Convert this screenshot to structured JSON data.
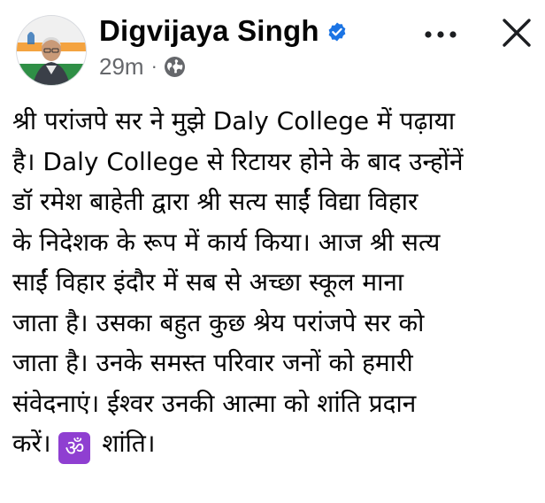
{
  "post": {
    "author": {
      "name": "Digvijaya Singh",
      "verified": true
    },
    "time": "29m",
    "separator": "·",
    "audience_icon": "globe-icon",
    "text_lines": [
      "श्री परांजपे सर ने मुझे Daly College में पढ़ाया",
      "है। Daly College से रिटायर होने के बाद उन्होंनें",
      "डॉ रमेश बाहेती द्वारा श्री सत्य साईं विद्या विहार",
      "के निदेशक के रूप में कार्य किया। आज श्री सत्य",
      "साईं विहार इंदौर में सब से अच्छा स्कूल माना",
      "जाता है। उसका बहुत कुछ श्रेय परांजपे सर को",
      "जाता है। उनके समस्त परिवार जनों को हमारी",
      "संवेदनाएं। ईश्वर उनकी आत्मा को शांति प्रदान"
    ],
    "last_line_prefix": "करें।",
    "om_emoji": "ॐ",
    "last_line_suffix": "शांति।"
  },
  "icons": {
    "more": "more-dots-icon",
    "close": "close-icon",
    "verified": "verified-badge-icon"
  },
  "colors": {
    "verified_blue": "#1b74e4",
    "secondary_text": "#65676b",
    "om_background": "#8f3fd1"
  }
}
